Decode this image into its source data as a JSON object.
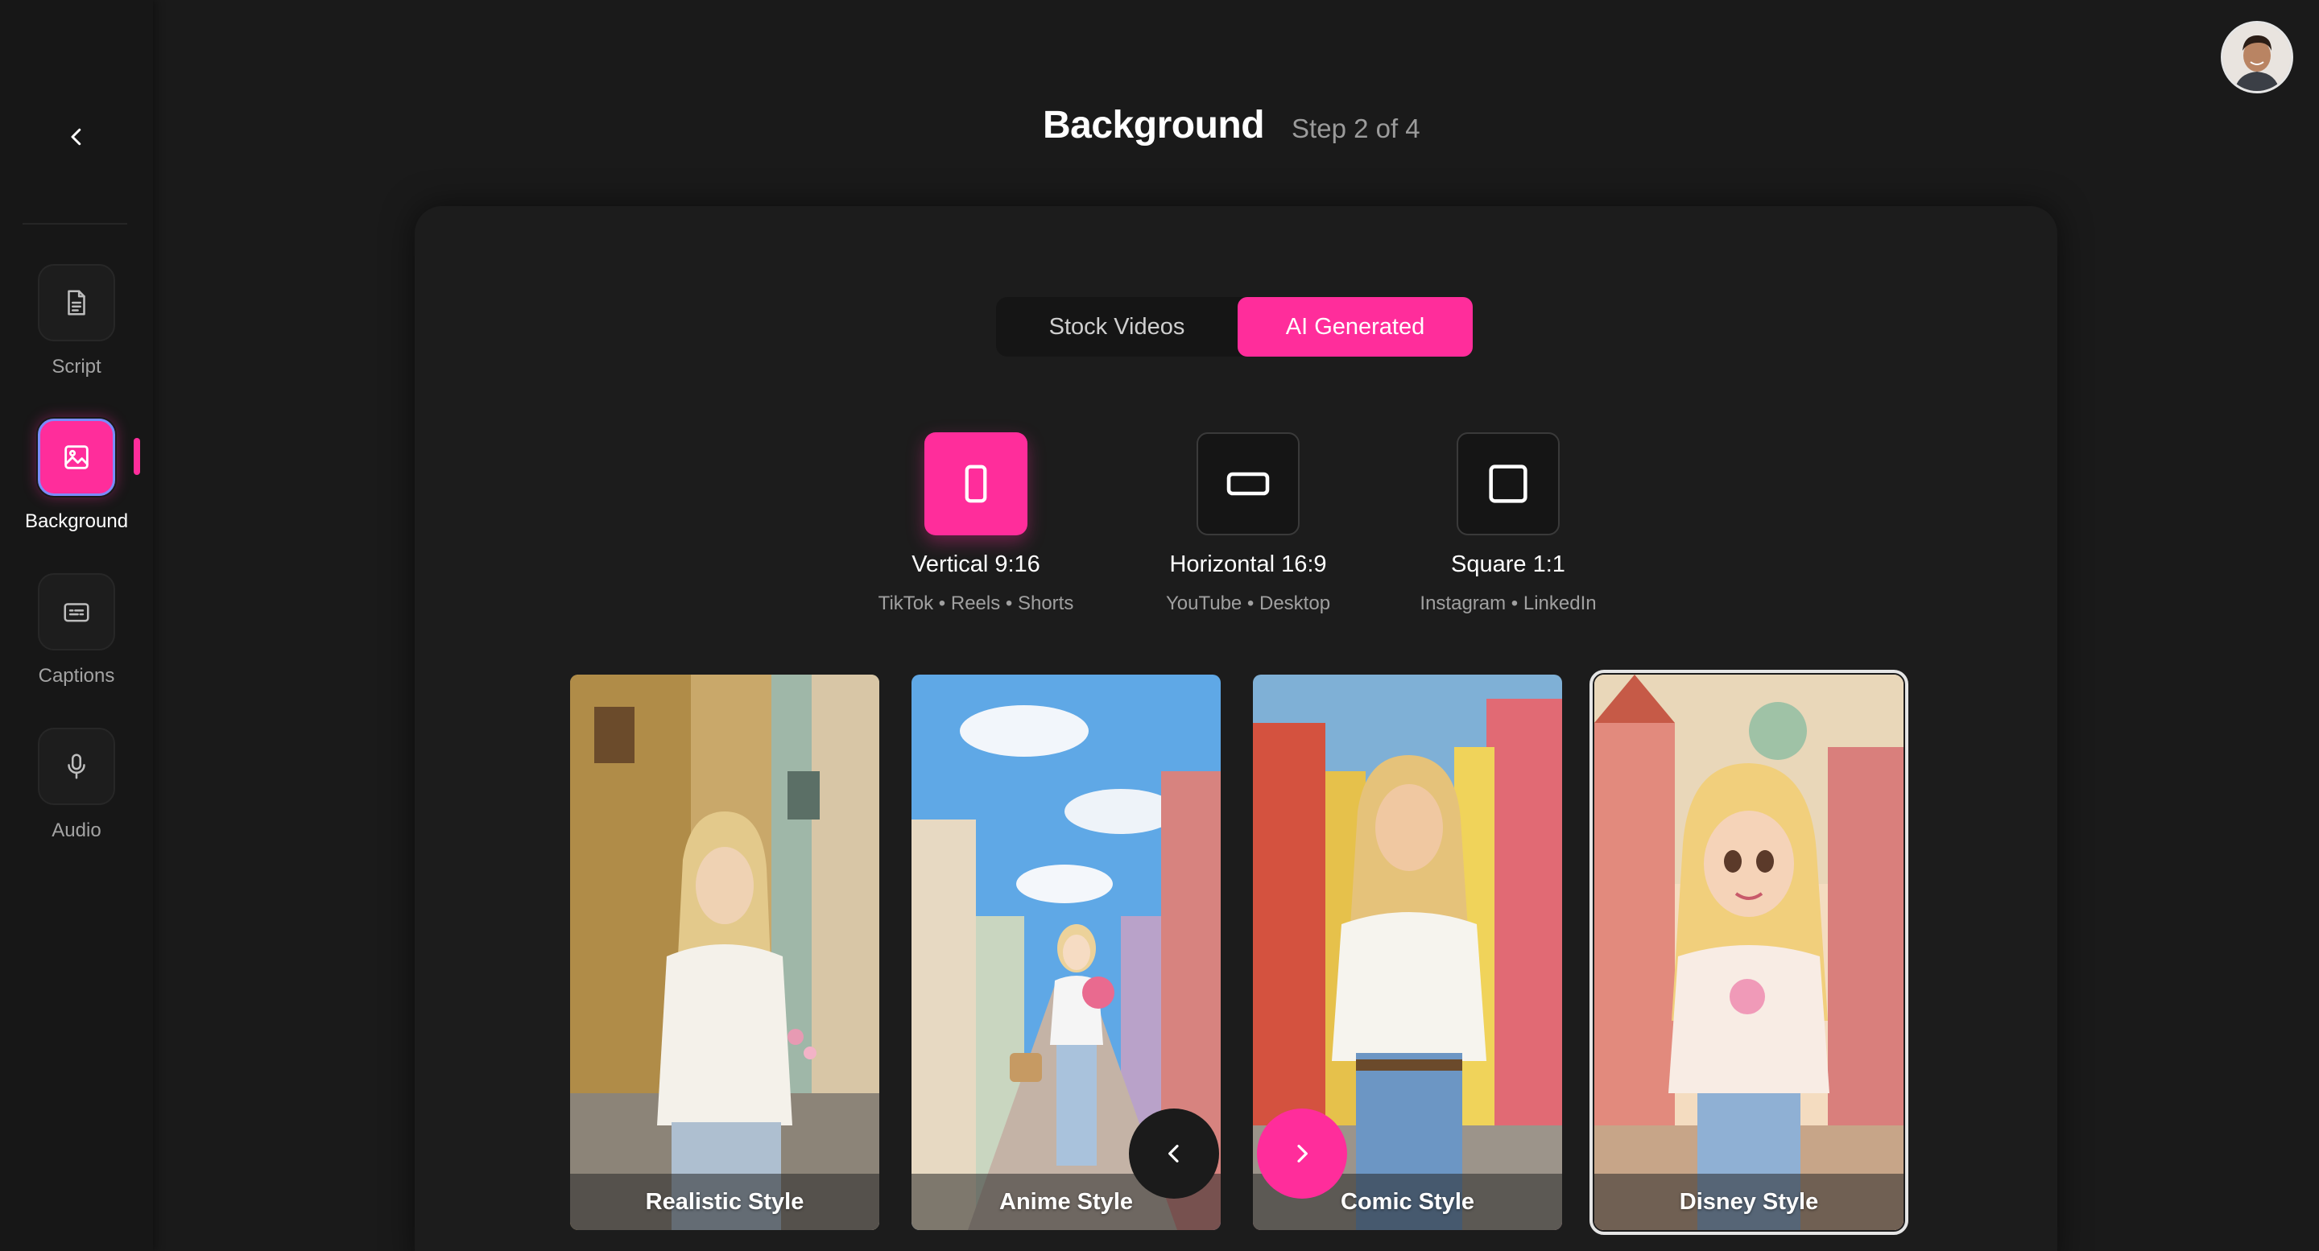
{
  "sidebar": {
    "back_icon": "chevron-left-icon",
    "items": [
      {
        "label": "Script",
        "icon": "document-icon",
        "active": false
      },
      {
        "label": "Background",
        "icon": "image-icon",
        "active": true
      },
      {
        "label": "Captions",
        "icon": "captions-icon",
        "active": false
      },
      {
        "label": "Audio",
        "icon": "microphone-icon",
        "active": false
      }
    ]
  },
  "header": {
    "title": "Background",
    "step": "Step 2 of 4"
  },
  "source_toggle": {
    "options": [
      "Stock Videos",
      "AI Generated"
    ],
    "selected": "AI Generated"
  },
  "aspect_ratios": [
    {
      "title": "Vertical 9:16",
      "subtitle": "TikTok • Reels • Shorts",
      "active": true
    },
    {
      "title": "Horizontal 16:9",
      "subtitle": "YouTube • Desktop",
      "active": false
    },
    {
      "title": "Square 1:1",
      "subtitle": "Instagram • LinkedIn",
      "active": false
    }
  ],
  "styles": [
    {
      "label": "Realistic Style",
      "selected": false
    },
    {
      "label": "Anime Style",
      "selected": false
    },
    {
      "label": "Comic Style",
      "selected": false
    },
    {
      "label": "Disney Style",
      "selected": true
    }
  ],
  "carousel": {
    "prev_icon": "chevron-left-icon",
    "next_icon": "chevron-right-icon"
  },
  "colors": {
    "accent": "#ff2d9b",
    "background": "#1a1a1a",
    "panel": "#1c1c1c",
    "selection_ring": "#7b8cff"
  }
}
